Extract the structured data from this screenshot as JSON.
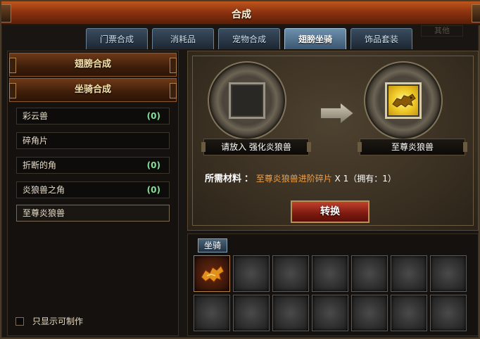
{
  "window": {
    "title": "合成"
  },
  "tabs": [
    {
      "label": "门票合成",
      "active": false
    },
    {
      "label": "消耗品",
      "active": false
    },
    {
      "label": "宠物合成",
      "active": false
    },
    {
      "label": "翅膀坐骑",
      "active": true
    },
    {
      "label": "饰品套装",
      "active": false
    }
  ],
  "tab_extra": "其他",
  "categories": [
    {
      "label": "翅膀合成"
    },
    {
      "label": "坐骑合成"
    }
  ],
  "recipes": [
    {
      "name": "彩云兽",
      "count": "(0)"
    },
    {
      "name": "碎角片",
      "count": ""
    },
    {
      "name": "折断的角",
      "count": "(0)"
    },
    {
      "name": "炎狼兽之角",
      "count": "(0)"
    },
    {
      "name": "至尊炎狼兽",
      "count": "",
      "selected": true
    }
  ],
  "filter": {
    "label": "只显示可制作",
    "checked": false
  },
  "synthesis": {
    "input_label": "请放入 强化炎狼兽",
    "output_label": "至尊炎狼兽",
    "materials_label": "所需材料",
    "materials_item": "至尊炎狼兽进阶碎片",
    "materials_qty": "X 1（拥有：1）",
    "convert_button": "转换",
    "output_icon": "gold-wolf-mount-icon"
  },
  "bag": {
    "tab_label": "坐骑",
    "slots": [
      {
        "icon": "red-wolf-mount-icon"
      },
      {},
      {},
      {},
      {},
      {},
      {},
      {},
      {},
      {},
      {},
      {},
      {},
      {}
    ]
  },
  "colors": {
    "title_bar": "#a5441a",
    "tab_active": "#5a7c9a",
    "count_green": "#84e09a",
    "material_orange": "#f2a048",
    "convert_red": "#9a2a18"
  }
}
